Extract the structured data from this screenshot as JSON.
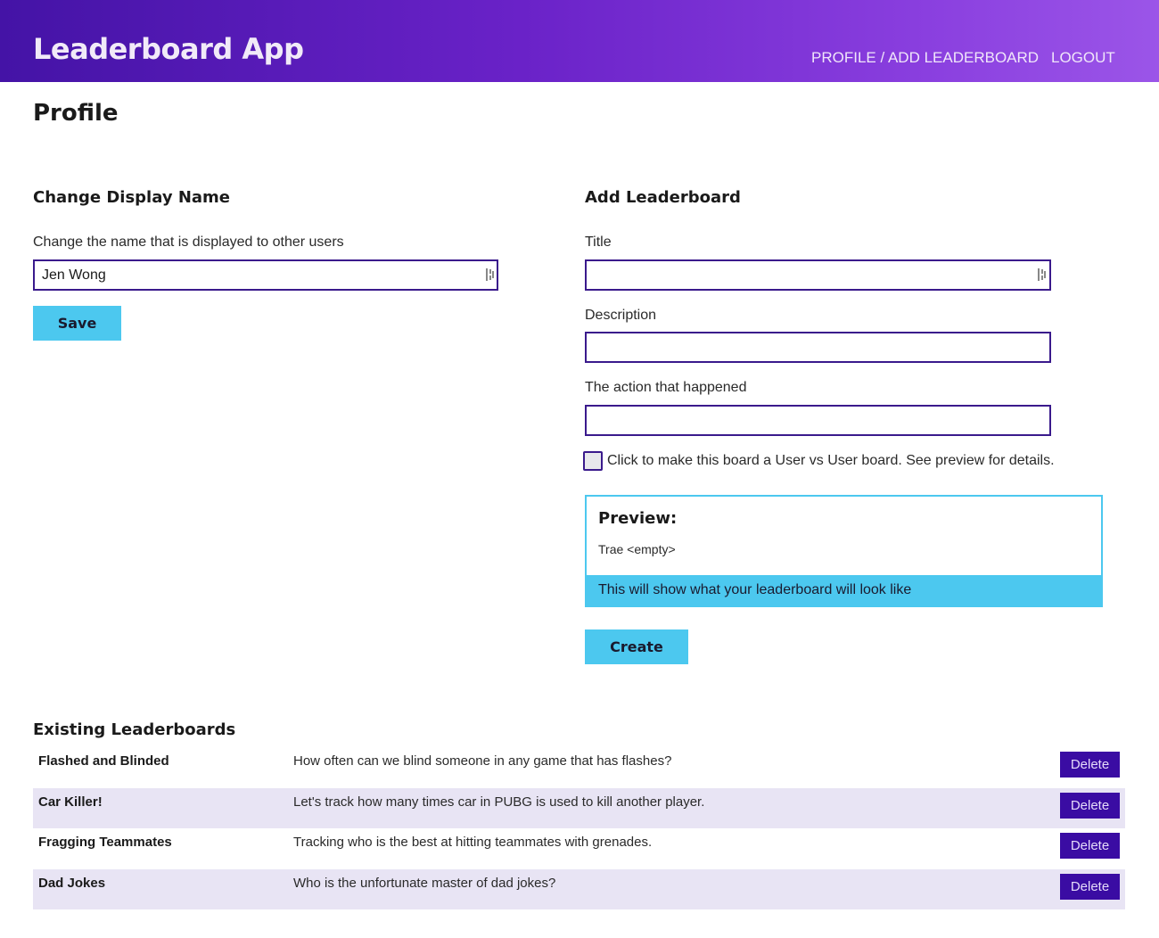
{
  "header": {
    "brand": "Leaderboard App",
    "nav": [
      {
        "label": "PROFILE / ADD LEADERBOARD"
      },
      {
        "label": "LOGOUT"
      }
    ]
  },
  "page": {
    "title": "Profile"
  },
  "display_name": {
    "section_title": "Change Display Name",
    "label": "Change the name that is displayed to other users",
    "value": "Jen Wong",
    "save_label": "Save"
  },
  "add_leaderboard": {
    "section_title": "Add Leaderboard",
    "title_label": "Title",
    "title_value": "",
    "description_label": "Description",
    "description_value": "",
    "action_label": "The action that happened",
    "action_value": "",
    "user_vs_user_label": "Click to make this board a User vs User board. See preview for details.",
    "user_vs_user_checked": false,
    "preview": {
      "title": "Preview:",
      "entry": "Trae <empty>",
      "footer": "This will show what your leaderboard will look like"
    },
    "create_label": "Create"
  },
  "existing": {
    "section_title": "Existing Leaderboards",
    "delete_label": "Delete",
    "rows": [
      {
        "name": "Flashed and Blinded",
        "description": "How often can we blind someone in any game that has flashes?"
      },
      {
        "name": "Car Killer!",
        "description": "Let's track how many times car in PUBG is used to kill another player."
      },
      {
        "name": "Fragging Teammates",
        "description": "Tracking who is the best at hitting teammates with grenades."
      },
      {
        "name": "Dad Jokes",
        "description": "Who is the unfortunate master of dad jokes?"
      }
    ]
  },
  "colors": {
    "header_start": "#4413a6",
    "header_end": "#9b55e8",
    "accent_cyan": "#4cc8ef",
    "delete_button": "#3a0ca3",
    "input_border": "#3a1a8c",
    "row_alt": "#e8e4f4"
  }
}
